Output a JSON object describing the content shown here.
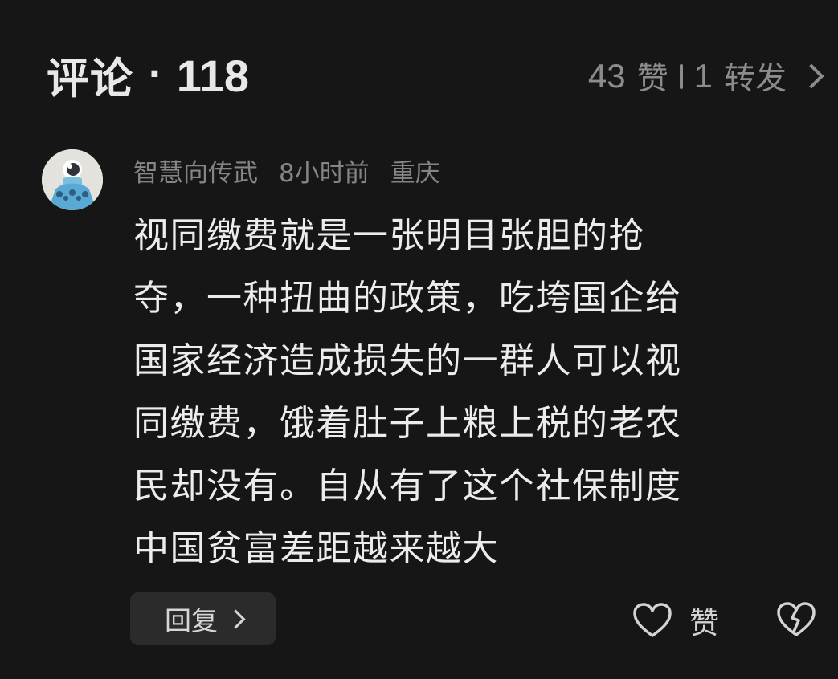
{
  "header": {
    "title": "评论",
    "separator": "·",
    "count": "118",
    "likes_count": "43",
    "likes_label": "赞",
    "reposts_count": "1",
    "reposts_label": "转发"
  },
  "comment": {
    "username": "智慧向传武",
    "time": "8小时前",
    "location": "重庆",
    "text": "视同缴费就是一张明目张胆的抢\n夺，一种扭曲的政策，吃垮国企给\n国家经济造成损失的一群人可以视\n同缴费，饿着肚子上粮上税的老农\n民却没有。自从有了这个社保制度\n中国贫富差距越来越大",
    "reply_label": "回复",
    "like_label": "赞"
  },
  "colors": {
    "background": "#161616",
    "primary_text": "#e8e8e8",
    "secondary_text": "#858585",
    "reply_background": "#2b2b2b",
    "avatar_blue": "#78bfe0",
    "avatar_light": "#e4e2dd"
  },
  "icons": {
    "avatar": "cartoon-alien-avatar",
    "chevron": "chevron-right-icon",
    "like": "heart-outline-icon",
    "dislike": "broken-heart-outline-icon"
  }
}
